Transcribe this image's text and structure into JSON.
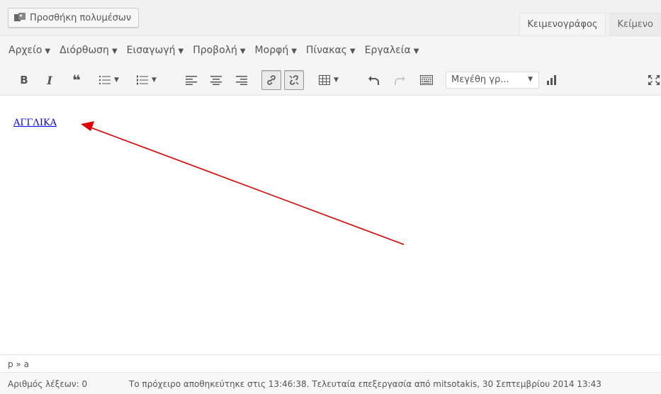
{
  "toolbar_top": {
    "add_media_label": "Προσθήκη πολυμέσων",
    "tabs": [
      {
        "label": "Κειμενογράφος",
        "active": true
      },
      {
        "label": "Κείμενο",
        "active": false
      }
    ]
  },
  "menubar": {
    "items": [
      {
        "label": "Αρχείο"
      },
      {
        "label": "Διόρθωση"
      },
      {
        "label": "Εισαγωγή"
      },
      {
        "label": "Προβολή"
      },
      {
        "label": "Μορφή"
      },
      {
        "label": "Πίνακας"
      },
      {
        "label": "Εργαλεία"
      }
    ],
    "arrow": "▼"
  },
  "format_toolbar": {
    "bold": "B",
    "italic": "I",
    "quote": "❝",
    "font_size_placeholder": "Μεγέθη γρ...",
    "dropdown_arrow": "▼"
  },
  "content": {
    "link_text": "ΑΓΓΛΙΚΑ"
  },
  "path": {
    "text": "p » a"
  },
  "status": {
    "word_count": "Αριθμός λέξεων: 0",
    "saved_text": "Το πρόχειρο αποθηκεύτηκε στις 13:46:38. Τελευταία επεξεργασία από mitsotakis, 30 Σεπτεμβρίου 2014 13:43"
  },
  "colors": {
    "link": "#0000ee",
    "annotation_arrow": "#e00000",
    "toolbar_bg": "#f5f5f5"
  }
}
